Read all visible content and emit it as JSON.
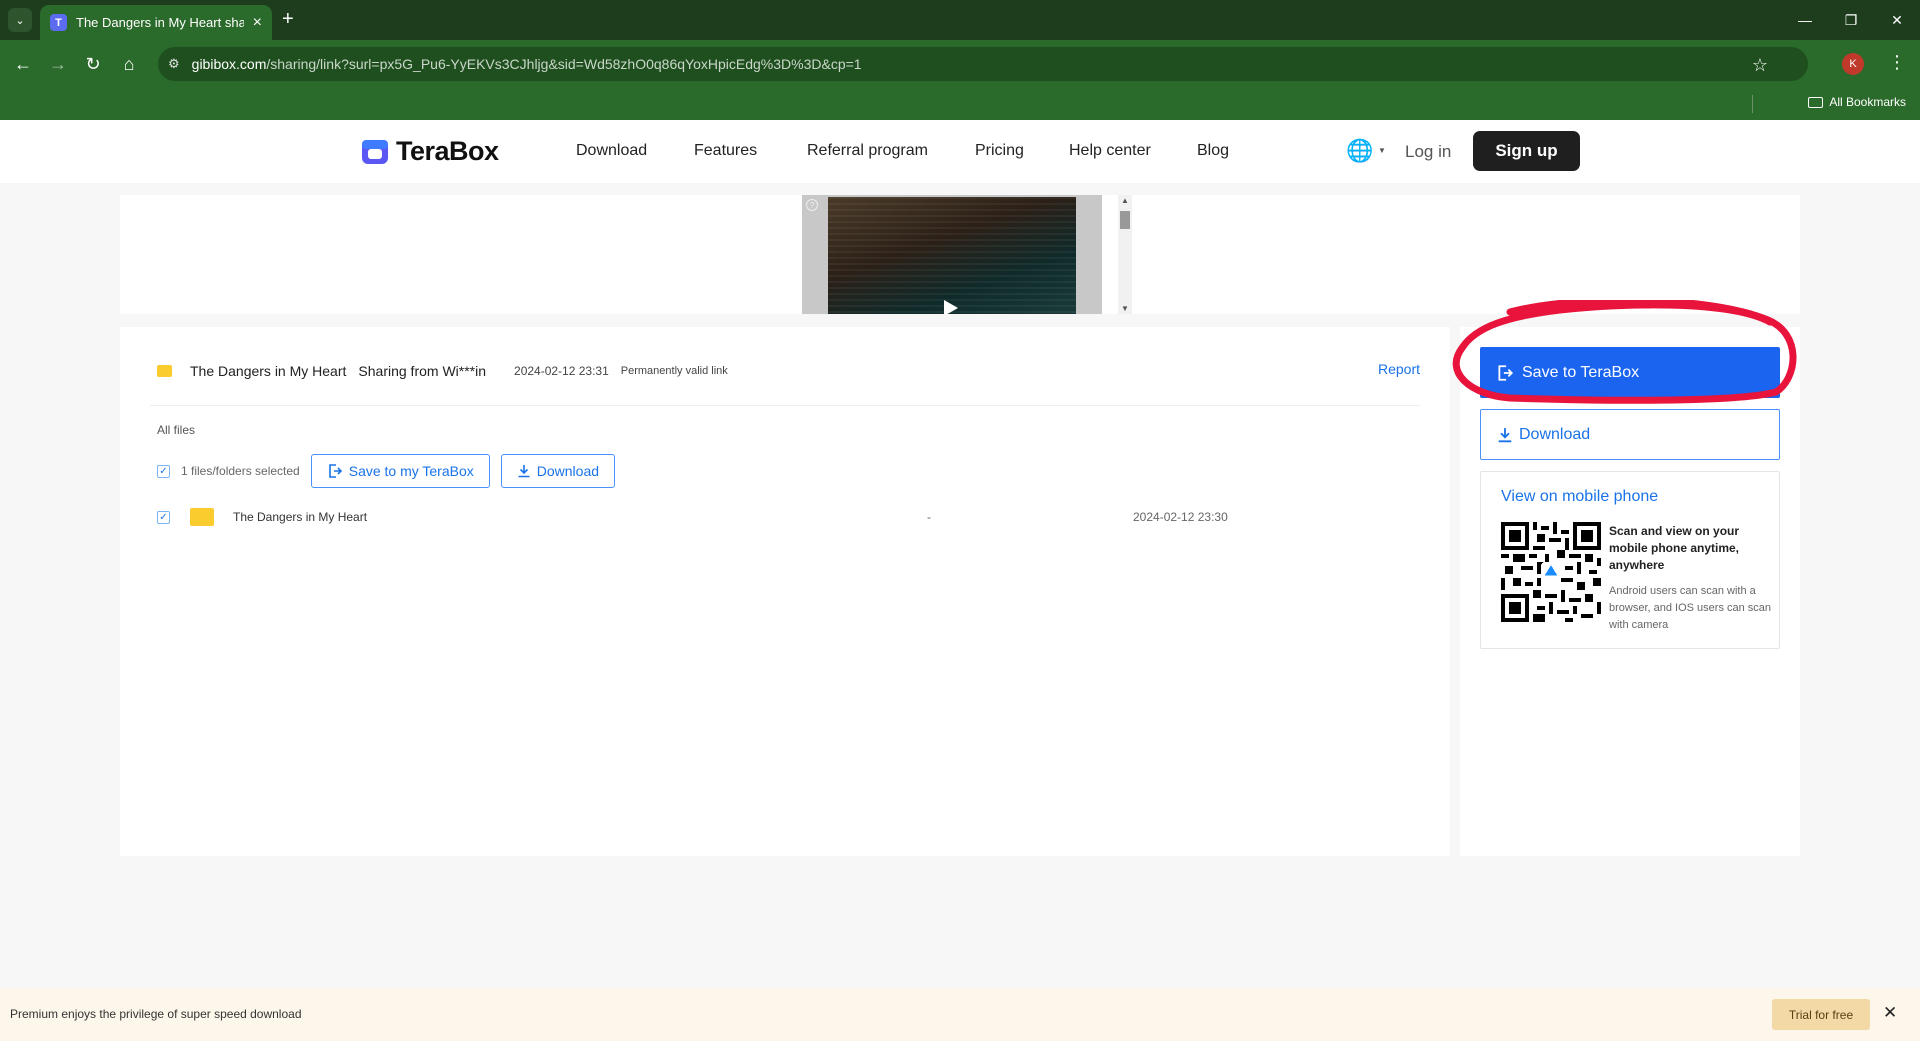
{
  "browser": {
    "tab_title": "The Dangers in My Heart shared",
    "url_host": "gibibox.com",
    "url_path": "/sharing/link?surl=px5G_Pu6-YyEKVs3CJhljg&sid=Wd58zhO0q86qYoxHpicEdg%3D%3D&cp=1",
    "profile_initial": "K",
    "all_bookmarks": "All Bookmarks"
  },
  "header": {
    "logo_text": "TeraBox",
    "nav": [
      "Download",
      "Features",
      "Referral program",
      "Pricing",
      "Help center",
      "Blog"
    ],
    "login": "Log in",
    "signup": "Sign up"
  },
  "share": {
    "title": "The Dangers in My Heart",
    "from": "Sharing from Wi***in",
    "date": "2024-02-12 23:31",
    "validity": "Permanently valid link",
    "report": "Report",
    "all_files": "All files",
    "selected_text": "1 files/folders selected",
    "save_btn": "Save to my TeraBox",
    "download_btn": "Download",
    "files": [
      {
        "name": "The Dangers in My Heart",
        "size": "-",
        "date": "2024-02-12 23:30"
      }
    ]
  },
  "side": {
    "save_btn": "Save to TeraBox",
    "download_btn": "Download",
    "mobile_title": "View on mobile phone",
    "qr_caption": "Scan and view on your mobile phone anytime, anywhere",
    "qr_note": "Android users can scan with a browser, and IOS users can scan with camera"
  },
  "promo": {
    "text": "Premium enjoys the privilege of super speed download",
    "trial_btn": "Trial for free"
  },
  "colors": {
    "browser_green": "#2a6a2a",
    "accent_blue": "#1a64f0",
    "annotation_red": "#e8143c"
  }
}
